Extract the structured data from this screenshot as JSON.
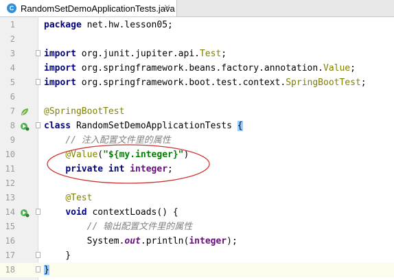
{
  "tab": {
    "icon": "class-icon",
    "title": "RandomSetDemoApplicationTests.java",
    "close": "×"
  },
  "lines": [
    {
      "n": "1",
      "parts": [
        [
          "kw",
          "package"
        ],
        [
          "",
          "net.hw.lesson05;"
        ]
      ]
    },
    {
      "n": "2",
      "parts": []
    },
    {
      "n": "3",
      "parts": [
        [
          "kw",
          "import"
        ],
        [
          "",
          "org.junit.jupiter.api."
        ],
        [
          "ann",
          "Test"
        ],
        [
          "",
          ";"
        ]
      ]
    },
    {
      "n": "4",
      "parts": [
        [
          "kw",
          "import"
        ],
        [
          "",
          "org.springframework.beans.factory.annotation."
        ],
        [
          "ann",
          "Value"
        ],
        [
          "",
          ";"
        ]
      ]
    },
    {
      "n": "5",
      "parts": [
        [
          "kw",
          "import"
        ],
        [
          "",
          "org.springframework.boot.test.context."
        ],
        [
          "ann",
          "SpringBootTest"
        ],
        [
          "",
          ";"
        ]
      ]
    },
    {
      "n": "6",
      "parts": []
    },
    {
      "n": "7",
      "parts": [
        [
          "ann",
          "@SpringBootTest"
        ]
      ]
    },
    {
      "n": "8",
      "parts": [
        [
          "kw",
          "class"
        ],
        [
          "",
          "RandomSetDemoApplicationTests "
        ],
        [
          "brace",
          "{"
        ]
      ]
    },
    {
      "n": "9",
      "parts": [
        [
          "",
          "    "
        ],
        [
          "cmt",
          "// 注入配置文件里的属性"
        ]
      ]
    },
    {
      "n": "10",
      "parts": [
        [
          "",
          "    "
        ],
        [
          "ann",
          "@Value"
        ],
        [
          "",
          "("
        ],
        [
          "str",
          "\"${my.integer}\""
        ],
        [
          "",
          ")"
        ]
      ]
    },
    {
      "n": "11",
      "parts": [
        [
          "",
          "    "
        ],
        [
          "kw",
          "private int"
        ],
        [
          "",
          ""
        ],
        [
          "fld",
          "integer"
        ],
        [
          "",
          ";"
        ]
      ]
    },
    {
      "n": "12",
      "parts": []
    },
    {
      "n": "13",
      "parts": [
        [
          "",
          "    "
        ],
        [
          "ann",
          "@Test"
        ]
      ]
    },
    {
      "n": "14",
      "parts": [
        [
          "",
          "    "
        ],
        [
          "kw",
          "void"
        ],
        [
          "",
          "contextLoads() {"
        ]
      ]
    },
    {
      "n": "15",
      "parts": [
        [
          "",
          "        "
        ],
        [
          "cmt",
          "// 输出配置文件里的属性"
        ]
      ]
    },
    {
      "n": "16",
      "parts": [
        [
          "",
          "        System."
        ],
        [
          "static",
          "out"
        ],
        [
          "",
          ".println("
        ],
        [
          "fld",
          "integer"
        ],
        [
          "",
          ");"
        ]
      ]
    },
    {
      "n": "17",
      "parts": [
        [
          "",
          "    }"
        ]
      ]
    },
    {
      "n": "18",
      "parts": [
        [
          "brace",
          "}"
        ]
      ]
    }
  ],
  "colors": {
    "annotation_ellipse": "#cc3333",
    "spring_icon": "#6db33f"
  }
}
